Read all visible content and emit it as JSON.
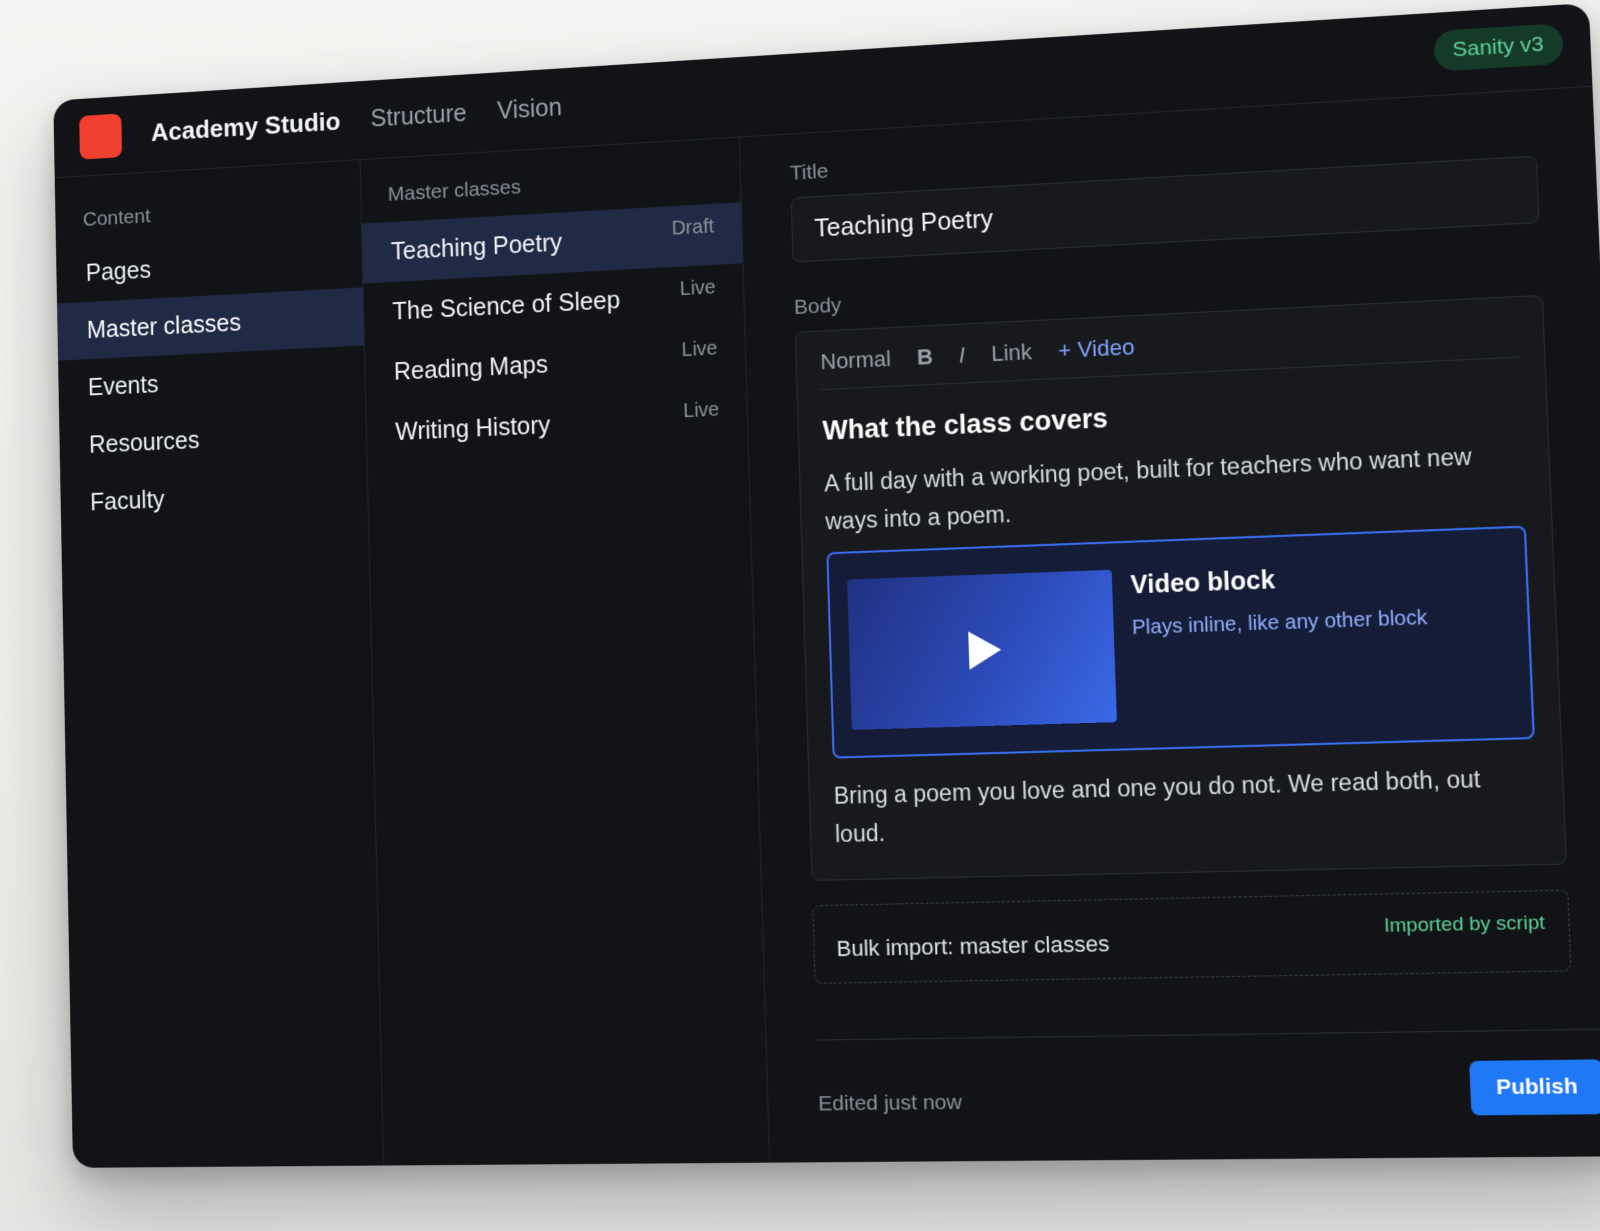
{
  "app": {
    "title": "Academy Studio",
    "nav": [
      "Structure",
      "Vision"
    ],
    "version_badge": "Sanity v3"
  },
  "sidebar": {
    "section_label": "Content",
    "items": [
      {
        "label": "Pages",
        "active": false
      },
      {
        "label": "Master classes",
        "active": true
      },
      {
        "label": "Events",
        "active": false
      },
      {
        "label": "Resources",
        "active": false
      },
      {
        "label": "Faculty",
        "active": false
      }
    ]
  },
  "list": {
    "section_label": "Master classes",
    "items": [
      {
        "title": "Teaching Poetry",
        "status": "Draft",
        "active": true
      },
      {
        "title": "The Science of Sleep",
        "status": "Live",
        "active": false
      },
      {
        "title": "Reading Maps",
        "status": "Live",
        "active": false
      },
      {
        "title": "Writing History",
        "status": "Live",
        "active": false
      }
    ]
  },
  "document": {
    "title_label": "Title",
    "title_value": "Teaching Poetry",
    "body_label": "Body",
    "toolbar": {
      "style": "Normal",
      "bold": "B",
      "italic": "I",
      "link": "Link",
      "insert_video": "+ Video"
    },
    "heading": "What the class covers",
    "paragraph_1": "A full day with a working poet, built for teachers who want new ways into a poem.",
    "video_block": {
      "title": "Video block",
      "subtitle": "Plays inline, like any other block"
    },
    "paragraph_2": "Bring a poem you love and one you do not. We read both, out loud.",
    "import": {
      "label": "Bulk import: master classes",
      "status": "Imported by script"
    }
  },
  "footer": {
    "edited": "Edited just now",
    "publish_label": "Publish"
  },
  "colors": {
    "logo": "#f03e2f",
    "accent": "#1f78f5",
    "active_row": "#1f2a44",
    "success": "#5fd49a",
    "video_border": "#3a6ef0"
  }
}
